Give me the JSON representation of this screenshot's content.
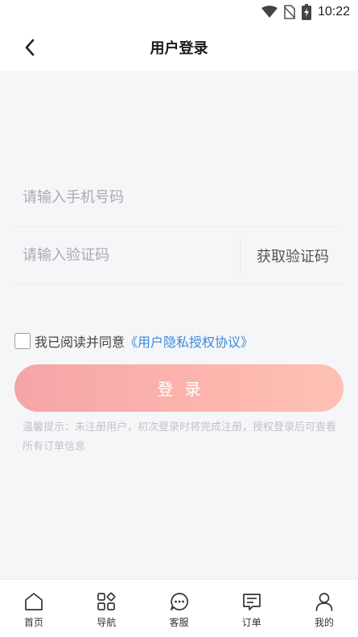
{
  "status_bar": {
    "time": "10:22",
    "icons": [
      "wifi-icon",
      "no-sim-icon",
      "battery-charging-icon"
    ]
  },
  "header": {
    "title": "用户登录",
    "back_icon": "chevron-left-icon"
  },
  "form": {
    "phone_placeholder": "请输入手机号码",
    "phone_value": "",
    "code_placeholder": "请输入验证码",
    "code_value": "",
    "get_code_label": "获取验证码"
  },
  "agreement": {
    "checked": false,
    "text": "我已阅读并同意",
    "link_label": "《用户隐私授权协议》"
  },
  "login_button": {
    "label": "登录"
  },
  "tip": "温馨提示：未注册用户，初次登录时将完成注册，授权登录后可查看所有订单信息",
  "tabbar": {
    "items": [
      {
        "label": "首页",
        "icon": "home-icon"
      },
      {
        "label": "导航",
        "icon": "grid-icon"
      },
      {
        "label": "客服",
        "icon": "chat-icon"
      },
      {
        "label": "订单",
        "icon": "order-icon"
      },
      {
        "label": "我的",
        "icon": "user-icon"
      }
    ]
  },
  "colors": {
    "link": "#3b8ad9",
    "button_start": "#f6a4a6",
    "button_end": "#ffc1b4",
    "background": "#f5f6f8"
  }
}
